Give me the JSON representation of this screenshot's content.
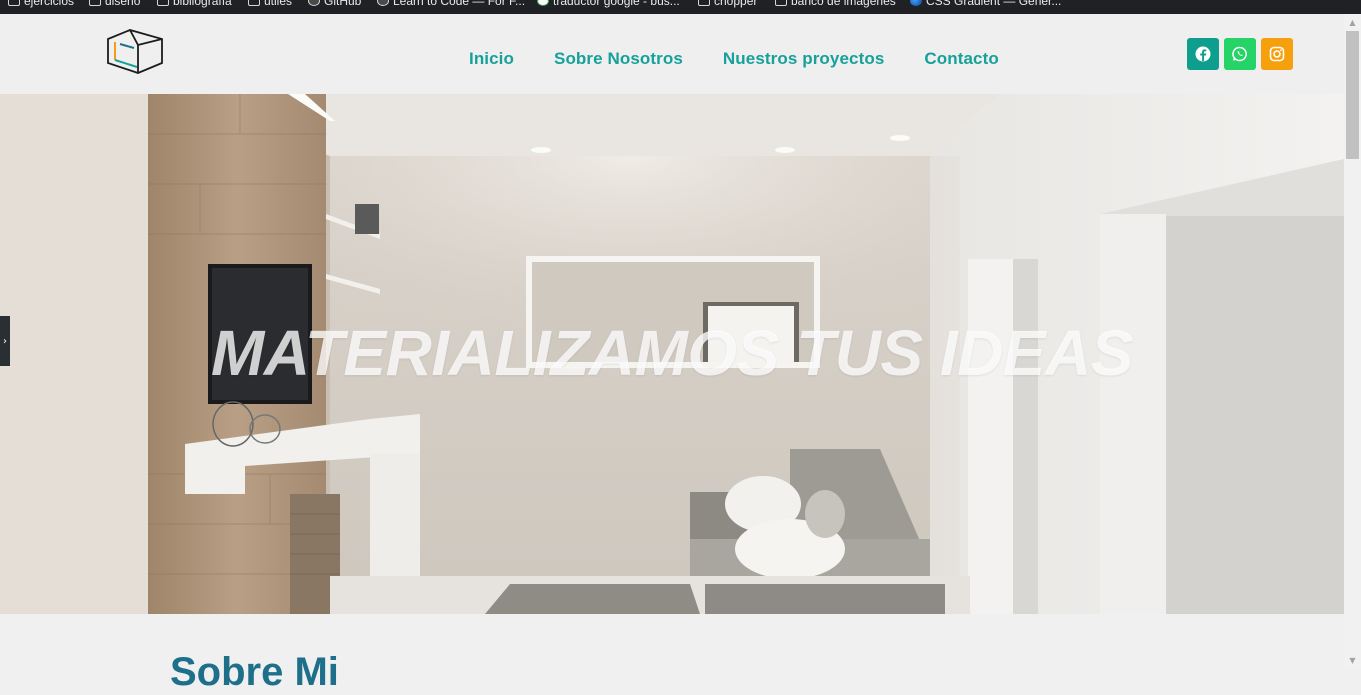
{
  "bookmarks": [
    {
      "label": "ejercicios",
      "icon": "folder-icon"
    },
    {
      "label": "diseño",
      "icon": "folder-icon"
    },
    {
      "label": "bibliografía",
      "icon": "folder-icon"
    },
    {
      "label": "útiles",
      "icon": "folder-icon"
    },
    {
      "label": "GitHub",
      "icon": "github-icon"
    },
    {
      "label": "Learn to Code — For F...",
      "icon": "freecodecamp-icon"
    },
    {
      "label": "traductor google - bus...",
      "icon": "google-icon"
    },
    {
      "label": "chopper",
      "icon": "folder-icon"
    },
    {
      "label": "banco de imágenes",
      "icon": "folder-icon"
    },
    {
      "label": "CSS Gradient — Gener...",
      "icon": "cssgradient-icon"
    }
  ],
  "nav": {
    "items": [
      "Inicio",
      "Sobre Nosotros",
      "Nuestros proyectos",
      "Contacto"
    ],
    "color": "#16a19a"
  },
  "socials": [
    {
      "name": "facebook-icon",
      "color": "#0e9e8e"
    },
    {
      "name": "whatsapp-icon",
      "color": "#25d366"
    },
    {
      "name": "instagram-icon",
      "color": "#f5a00c"
    }
  ],
  "hero": {
    "title": "MATERIALIZAMOS TUS IDEAS"
  },
  "section": {
    "title": "Sobre Mi"
  }
}
